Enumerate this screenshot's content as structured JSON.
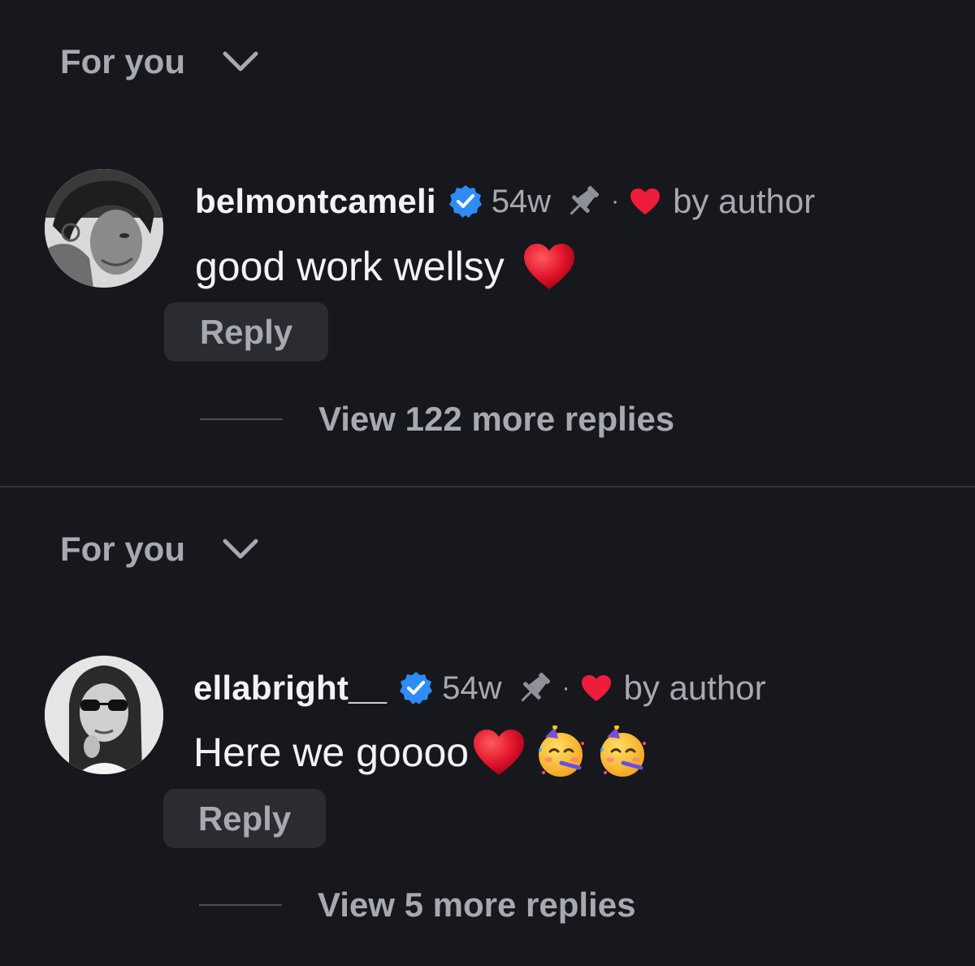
{
  "threads": [
    {
      "sort_label": "For you",
      "username": "belmontcameli",
      "time": "54w",
      "separator": "·",
      "liked_by": "by author",
      "comment": "good work wellsy",
      "reply_label": "Reply",
      "view_more": "View 122 more replies"
    },
    {
      "sort_label": "For you",
      "username": "ellabright__",
      "time": "54w",
      "separator": "·",
      "liked_by": "by author",
      "comment": "Here we goooo",
      "reply_label": "Reply",
      "view_more": "View 5 more replies"
    }
  ],
  "colors": {
    "background": "#16181d",
    "primary_text": "#f2f3f5",
    "secondary_text": "#a6a9b0",
    "verified_blue": "#2f8cf7",
    "heart_red": "#ee1d3b",
    "reply_bg": "#2a2c32"
  },
  "icons": {
    "sort_toggle": "chevron-down-icon",
    "verified": "verified-badge-icon",
    "pinned": "pin-icon",
    "author_like": "heart-icon",
    "emoji_heart": "red-heart-emoji",
    "emoji_party": "partying-face-emoji"
  }
}
